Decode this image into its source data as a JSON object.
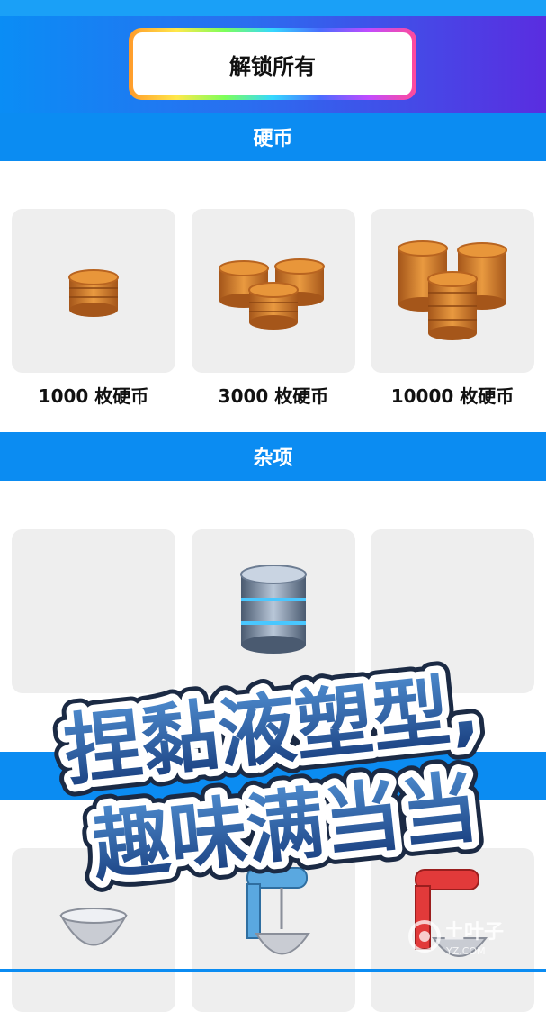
{
  "header": {
    "unlock_all_label": "解锁所有"
  },
  "sections": [
    {
      "title": "硬币",
      "items": [
        {
          "label": "1000 枚硬币",
          "icon": "coin-stack-small-icon"
        },
        {
          "label": "3000 枚硬币",
          "icon": "coin-stack-medium-icon"
        },
        {
          "label": "10000 枚硬币",
          "icon": "coin-stack-large-icon"
        }
      ]
    },
    {
      "title": "杂项",
      "items": [
        {
          "label": "",
          "icon": "empty"
        },
        {
          "label": "",
          "icon": "cylinder-stack-icon"
        },
        {
          "label": "",
          "icon": "empty"
        }
      ]
    },
    {
      "title": "",
      "items": [
        {
          "label": "",
          "icon": "bowl-icon"
        },
        {
          "label": "",
          "icon": "blue-stand-mixer-icon"
        },
        {
          "label": "",
          "icon": "red-stand-mixer-icon"
        }
      ]
    }
  ],
  "promo_banner": {
    "line1": "捏黏液塑型,",
    "line2": "趣味满当当"
  },
  "watermark": {
    "text": "土叶子",
    "subtext": "YZ.COM"
  },
  "colors": {
    "accent": "#0b8cf2",
    "card_bg": "#eeeeee",
    "coin": "#d9822b"
  }
}
